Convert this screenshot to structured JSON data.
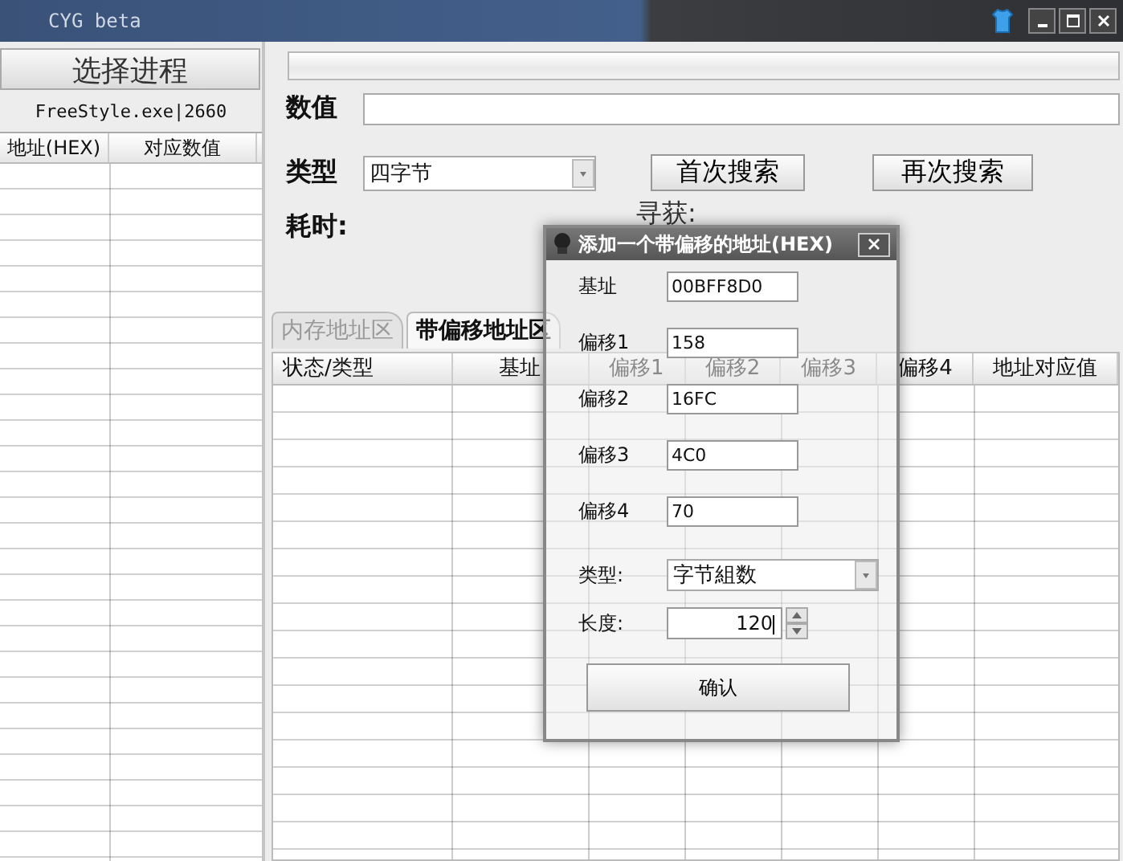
{
  "window": {
    "title": "CYG beta"
  },
  "progress": {
    "level": 0
  },
  "process": {
    "button": "选择进程",
    "name": "FreeStyle.exe|2660"
  },
  "left_table": {
    "columns": [
      "地址(HEX)",
      "对应数值"
    ]
  },
  "search": {
    "value_label": "数值",
    "type_label": "类型",
    "type": "四字节",
    "buttons": [
      "首次搜索",
      "再次搜索"
    ],
    "time_label": "耗时:",
    "found_label": "寻获:"
  },
  "tabs": [
    {
      "label": "内存地址区",
      "selected": false
    },
    {
      "label": "带偏移地址区",
      "selected": true
    }
  ],
  "table": {
    "columns": [
      "状态/类型",
      "基址",
      "偏移1",
      "偏移2",
      "偏移3",
      "偏移4",
      "地址对应值"
    ]
  },
  "dialog": {
    "title": "添加一个带偏移的地址(HEX)",
    "fields": [
      {
        "kind": "text",
        "label": "基址",
        "value": "00BFF8D0"
      },
      {
        "kind": "text",
        "label": "偏移1",
        "value": "158"
      },
      {
        "kind": "text",
        "label": "偏移2",
        "value": "16FC"
      },
      {
        "kind": "text",
        "label": "偏移3",
        "value": "4C0"
      },
      {
        "kind": "text",
        "label": "偏移4",
        "value": "70"
      },
      {
        "kind": "combo",
        "label": "类型:",
        "value": "字节組数"
      },
      {
        "kind": "spin",
        "label": "长度:",
        "value": "120"
      }
    ],
    "confirm": "确认"
  }
}
